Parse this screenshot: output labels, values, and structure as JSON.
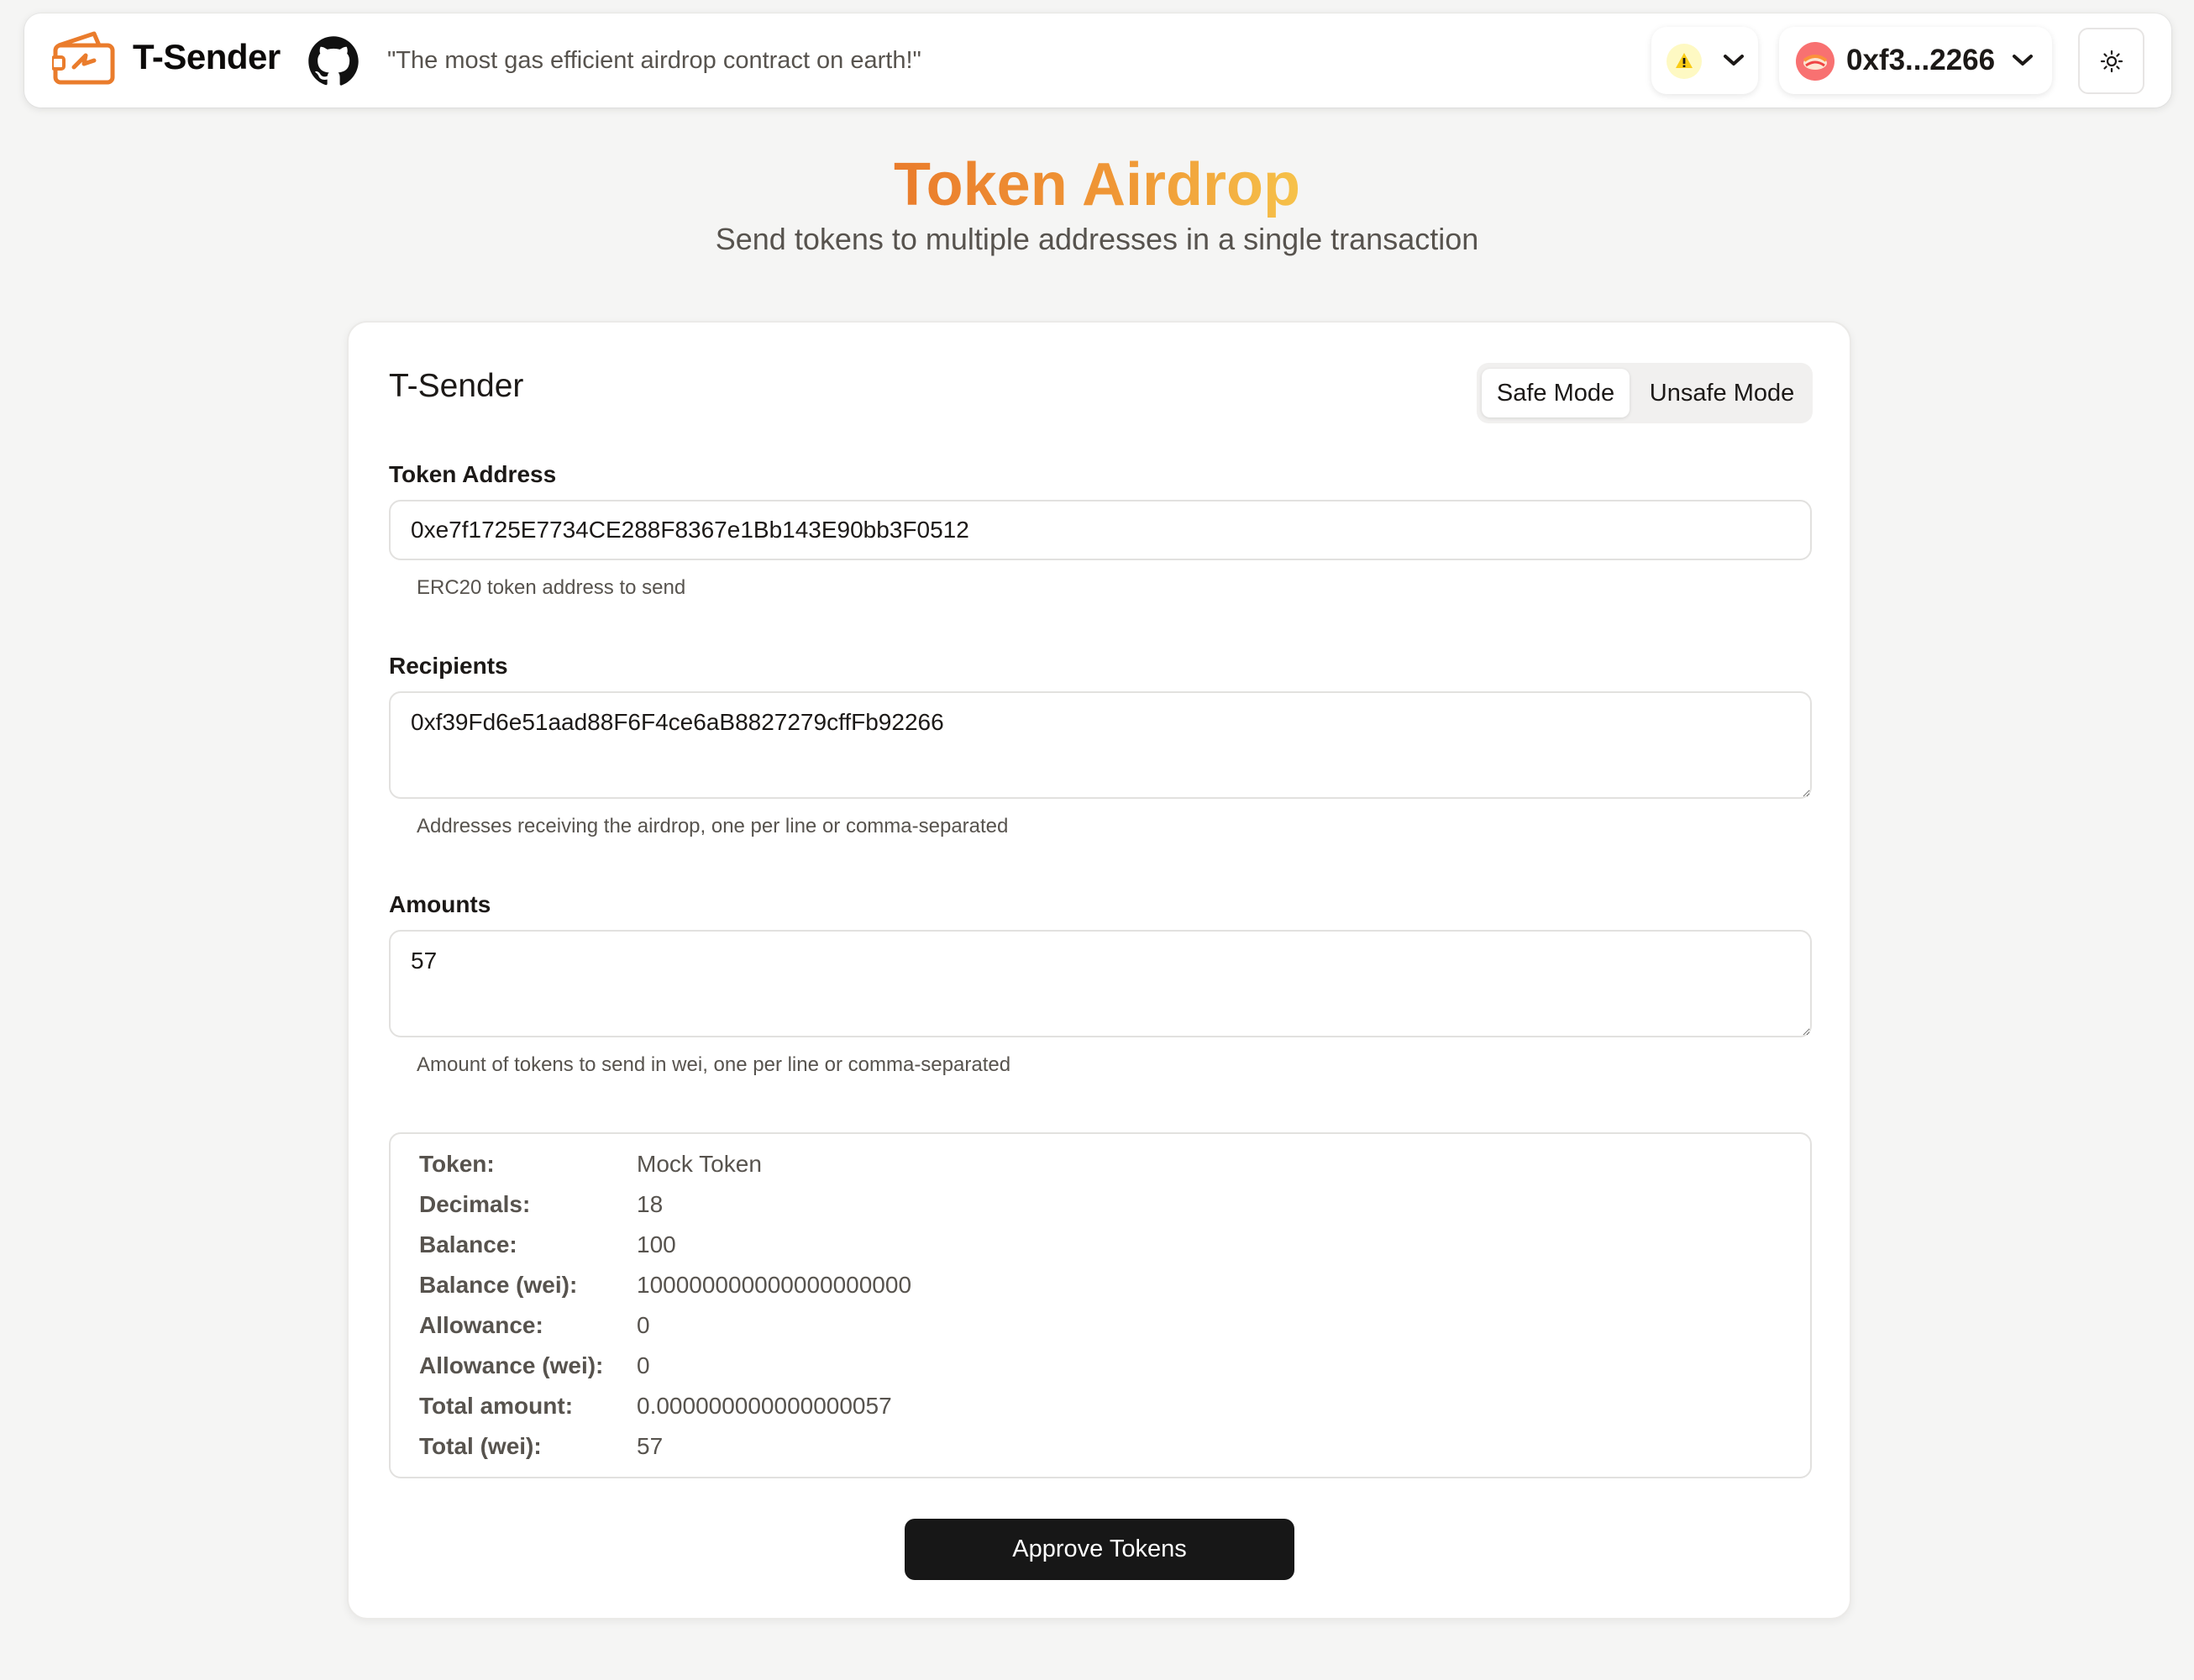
{
  "header": {
    "brand": "T-Sender",
    "tagline": "\"The most gas efficient airdrop contract on earth!\"",
    "account": "0xf3...2266",
    "icons": {
      "logo": "wallet-logo-icon",
      "github": "github-icon",
      "chain": "chain-warning-icon",
      "chevron": "chevron-down-icon",
      "theme": "sun-icon"
    }
  },
  "hero": {
    "title": "Token Airdrop",
    "subtitle": "Send tokens to multiple addresses in a single transaction"
  },
  "form": {
    "title": "T-Sender",
    "modes": {
      "safe": "Safe Mode",
      "unsafe": "Unsafe Mode",
      "selected": "Safe Mode"
    },
    "token_address": {
      "label": "Token Address",
      "value": "0xe7f1725E7734CE288F8367e1Bb143E90bb3F0512",
      "hint": "ERC20 token address to send"
    },
    "recipients": {
      "label": "Recipients",
      "value": "0xf39Fd6e51aad88F6F4ce6aB8827279cffFb92266",
      "hint": "Addresses receiving the airdrop, one per line or comma-separated"
    },
    "amounts": {
      "label": "Amounts",
      "value": "57",
      "hint": "Amount of tokens to send in wei, one per line or comma-separated"
    },
    "details": [
      {
        "key": "Token:",
        "value": "Mock Token"
      },
      {
        "key": "Decimals:",
        "value": "18"
      },
      {
        "key": "Balance:",
        "value": "100"
      },
      {
        "key": "Balance (wei):",
        "value": "100000000000000000000"
      },
      {
        "key": "Allowance:",
        "value": "0"
      },
      {
        "key": "Allowance (wei):",
        "value": "0"
      },
      {
        "key": "Total amount:",
        "value": "0.000000000000000057"
      },
      {
        "key": "Total (wei):",
        "value": "57"
      }
    ],
    "submit_label": "Approve Tokens"
  },
  "colors": {
    "accent": "#ea7c2c",
    "accent_light": "#f6c24a",
    "button_dark": "#171717",
    "background": "#f5f5f4"
  }
}
